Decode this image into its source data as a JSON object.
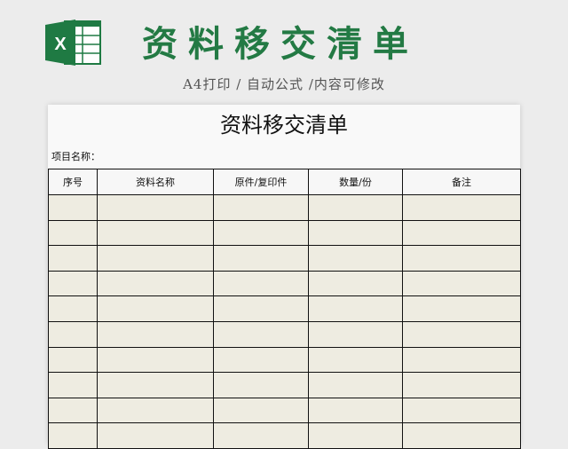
{
  "banner": {
    "logo_icon": "excel-icon",
    "logo_letter": "X",
    "title": "资料移交清单",
    "subtitle": "A4打印 / 自动公式 /内容可修改",
    "title_color": "#237a44",
    "logo_color": "#1f7a43"
  },
  "sheet": {
    "title": "资料移交清单",
    "project_label": "项目名称：",
    "columns": [
      "序号",
      "资料名称",
      "原件/复印件",
      "数量/份",
      "备注"
    ],
    "cell_fill": "#eeece1"
  }
}
